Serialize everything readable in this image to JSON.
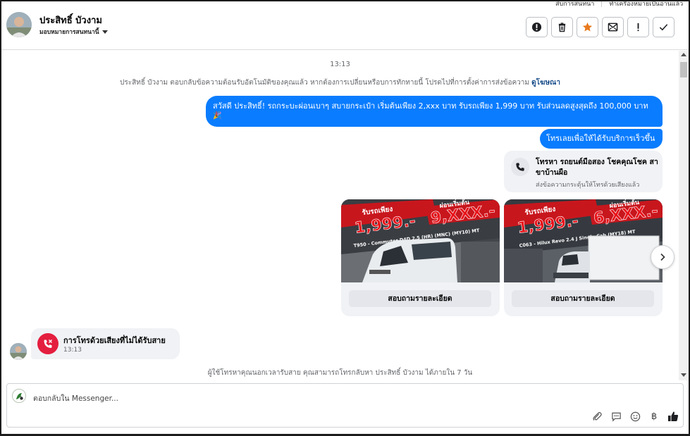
{
  "header": {
    "contact_name": "ประสิทธิ์ บัวงาม",
    "assign_label": "มอบหมายการสนทนานี้",
    "tooltip_items": [
      "สิบการสนทนา",
      "ทำเครื่องหมายเป็นอ่านแล้ว"
    ],
    "actions": [
      {
        "name": "spam-icon",
        "label": "spam"
      },
      {
        "name": "trash-icon",
        "label": "delete"
      },
      {
        "name": "star-icon",
        "label": "star"
      },
      {
        "name": "mark-unread-icon",
        "label": "unread"
      },
      {
        "name": "follow-up-icon",
        "label": "follow up"
      },
      {
        "name": "done-icon",
        "label": "done"
      }
    ]
  },
  "thread": {
    "timestamp": "13:13",
    "system_note": "ประสิทธิ์ บัวงาม ตอบกลับข้อความต้อนรับอัตโนมัติของคุณแล้ว หากต้องการเปลี่ยนหรือบการทักทายนี้ โปรดไปที่การตั้งค่าการส่งข้อความ",
    "system_note_link": "ดูโฆษณา",
    "message_1_line1": "สวัสดี ประสิทธิ์! รถกระบะผ่อนเบาๆ สบายกระเป๋า เริ่มต้นเพียง 2,xxx บาท รับรถเพียง 1,999 บาท รับส่วนลดสูงสุดถึง 100,000 บาท",
    "message_1_emoji": "🎉",
    "message_2": "โทรเลยเพื่อให้ได้รับบริการเร็วขึ้น",
    "call_card": {
      "title": "โทรหา รถยนต์มือสอง โชคคุณโชค สาขาบ้านผือ",
      "subtitle": "ส่งข้อความกระตุ้นให้โทรด้วยเสียงแล้ว"
    },
    "product_cards": [
      {
        "price_small": "รับรถเพียง",
        "price_big": "1,999.-",
        "promo_top": "ผ่อนเริ่มต้น",
        "promo": "9,XXX.-",
        "model": "T950 - Commuter D4D 2.5 (HR) (MNC) (MY10) MT",
        "button": "สอบถามรายละเอียด"
      },
      {
        "price_small": "รับรถเพียง",
        "price_big": "1,999.-",
        "promo_top": "ผ่อนเริ่มต้น",
        "promo": "6,XXX.-",
        "model": "C063 - Hilux Revo 2.4 J Single Cab (MY18) MT",
        "button": "สอบถามรายละเอียด"
      }
    ],
    "missed_call": {
      "title": "การโทรด้วยเสียงที่ไม่ได้รับสาย",
      "time": "13:13"
    },
    "bottom_note": "ผู้ใช้โทรหาคุณนอกเวลารับสาย คุณสามารถโทรกลับหา ประสิทธิ์ บัวงาม ได้ภายใน 7 วัน"
  },
  "composer": {
    "placeholder": "ตอบกลับใน Messenger...",
    "tools": [
      "attach-icon",
      "saved-reply-icon",
      "emoji-icon",
      "baht-icon",
      "like-icon"
    ],
    "baht_symbol": "฿"
  },
  "colors": {
    "accent_blue": "#0a7cff",
    "missed_red": "#e41e3f",
    "star_orange": "#e87a1d",
    "bubble_gray": "#f0f2f5"
  }
}
